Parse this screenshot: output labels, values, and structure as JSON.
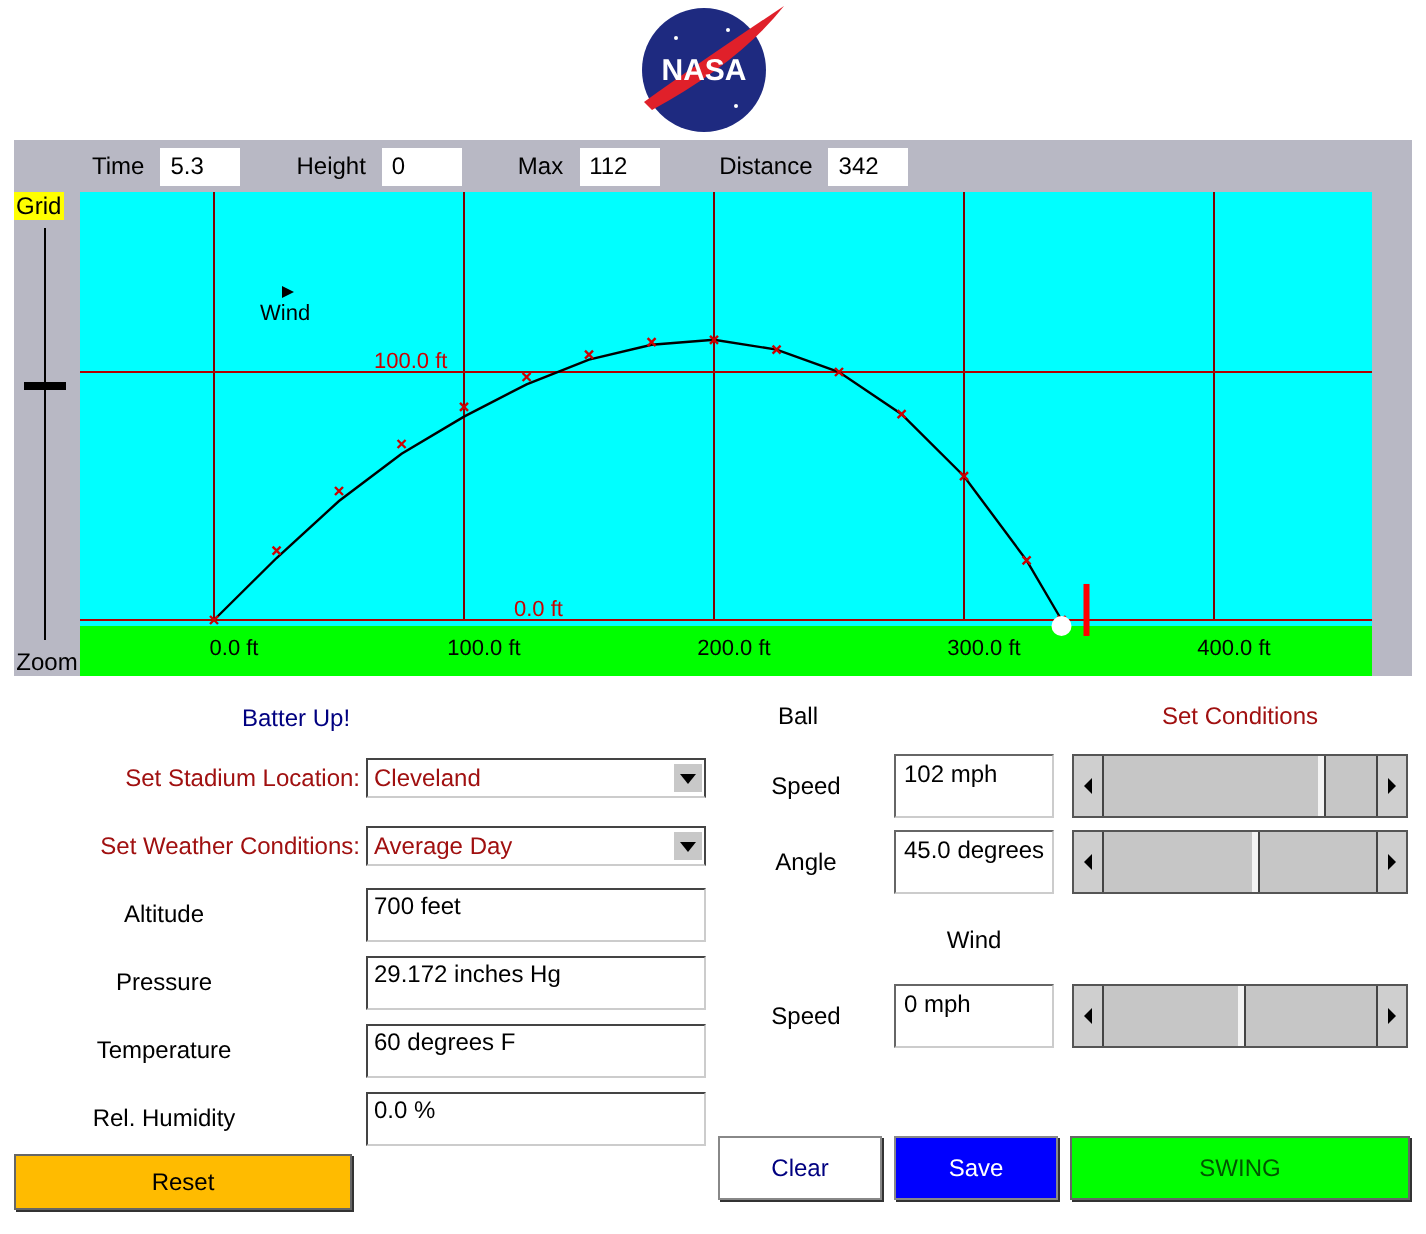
{
  "logo": {
    "text": "NASA"
  },
  "readouts": [
    {
      "label": "Time",
      "value": "5.3"
    },
    {
      "label": "Height",
      "value": "0"
    },
    {
      "label": "Max",
      "value": "112"
    },
    {
      "label": "Distance",
      "value": "342"
    }
  ],
  "zoom": {
    "grid_label": "Grid",
    "label": "Zoom",
    "level": 0.61
  },
  "plot": {
    "wind_label": "Wind",
    "x_labels": [
      "0.0 ft",
      "100.0 ft",
      "200.0 ft",
      "300.0 ft",
      "400.0 ft"
    ],
    "y_labels": [
      "100.0 ft",
      "0.0 ft"
    ]
  },
  "form": {
    "title": "Batter Up!",
    "selects": [
      {
        "label": "Set Stadium Location:",
        "value": "Cleveland"
      },
      {
        "label": "Set Weather Conditions:",
        "value": "Average Day"
      }
    ],
    "fields": [
      {
        "label": "Altitude",
        "value": "700 feet"
      },
      {
        "label": "Pressure",
        "value": "29.172 inches Hg"
      },
      {
        "label": "Temperature",
        "value": "60 degrees F"
      },
      {
        "label": "Rel. Humidity",
        "value": "0.0 %"
      }
    ],
    "reset": "Reset"
  },
  "ball": {
    "title": "Ball",
    "conditions_title": "Set Conditions",
    "controls": [
      {
        "label": "Speed",
        "value": "102 mph"
      },
      {
        "label": "Angle",
        "value": "45.0 degrees"
      }
    ]
  },
  "wind": {
    "title": "Wind",
    "controls": [
      {
        "label": "Speed",
        "value": "0 mph"
      }
    ]
  },
  "buttons": [
    {
      "label": "Clear",
      "kind": "clear"
    },
    {
      "label": "Save",
      "kind": "save"
    },
    {
      "label": "SWING",
      "kind": "swing"
    }
  ]
}
